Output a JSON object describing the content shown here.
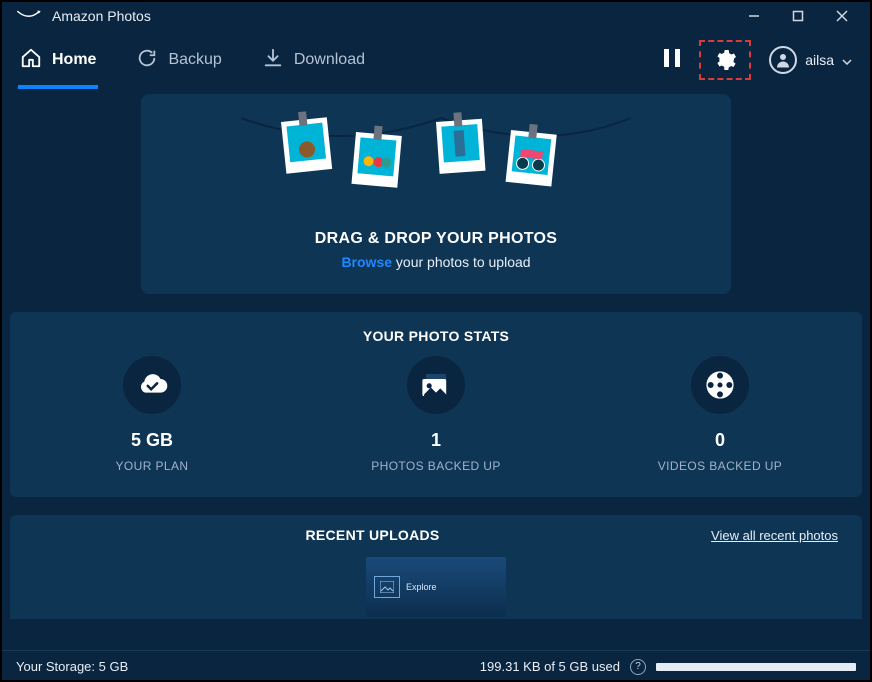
{
  "app": {
    "title": "Amazon Photos",
    "username": "ailsa"
  },
  "tabs": {
    "home": "Home",
    "backup": "Backup",
    "download": "Download"
  },
  "dropzone": {
    "title": "DRAG & DROP YOUR PHOTOS",
    "browse": "Browse",
    "suffix": " your photos to upload"
  },
  "stats": {
    "heading": "YOUR PHOTO STATS",
    "plan": {
      "value": "5 GB",
      "label": "YOUR PLAN"
    },
    "photos": {
      "value": "1",
      "label": "PHOTOS BACKED UP"
    },
    "videos": {
      "value": "0",
      "label": "VIDEOS BACKED UP"
    }
  },
  "recent": {
    "heading": "RECENT UPLOADS",
    "view_all": "View all recent photos",
    "thumb_caption": "Explore"
  },
  "status": {
    "storage_label": "Your Storage: 5 GB",
    "usage": "199.31 KB of 5 GB used"
  }
}
